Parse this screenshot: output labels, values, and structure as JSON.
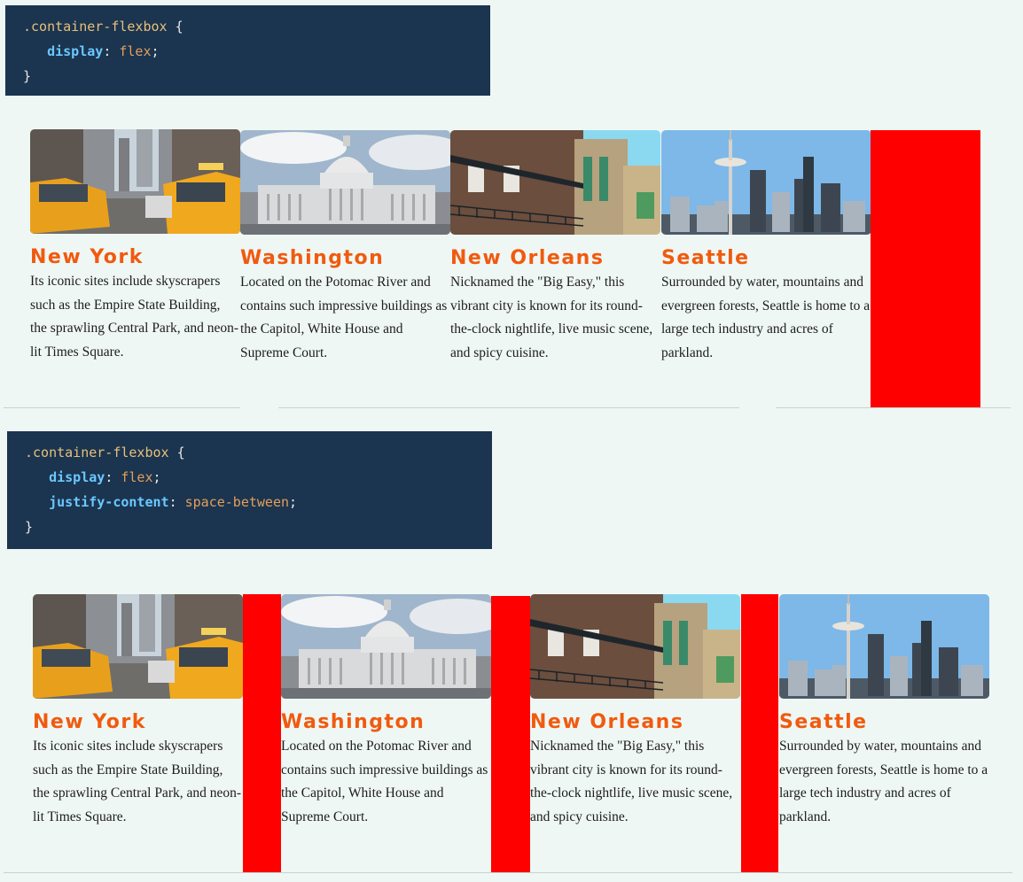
{
  "code_blocks": [
    {
      "selector": ".container-flexbox",
      "open": "{",
      "close": "}",
      "declarations": [
        {
          "prop": "display",
          "value": "flex"
        }
      ]
    },
    {
      "selector": ".container-flexbox",
      "open": "{",
      "close": "}",
      "declarations": [
        {
          "prop": "display",
          "value": "flex"
        },
        {
          "prop": "justify-content",
          "value": "space-between"
        }
      ]
    }
  ],
  "cities": [
    {
      "name": "New York",
      "description": "Its iconic sites include skyscrapers such as the Empire State Building, the sprawling Central Park, and neon-lit Times Square."
    },
    {
      "name": "Washington",
      "description": "Located on the Potomac River and contains such impressive buildings as the Capitol, White House and Supreme Court."
    },
    {
      "name": "New Orleans",
      "description": "Nicknamed the \"Big Easy,\" this vibrant city is known for its round-the-clock nightlife, live music scene, and spicy cuisine."
    },
    {
      "name": "Seattle",
      "description": "Surrounded by water, mountains and evergreen forests, Seattle is home to a large tech industry and acres of  parkland."
    }
  ],
  "colors": {
    "accent": "#f15a0e",
    "spacer": "#ff0000",
    "code_bg": "#1b344f"
  },
  "icons": [
    "taxi-street-photo",
    "capitol-photo",
    "balcony-photo",
    "space-needle-photo"
  ]
}
